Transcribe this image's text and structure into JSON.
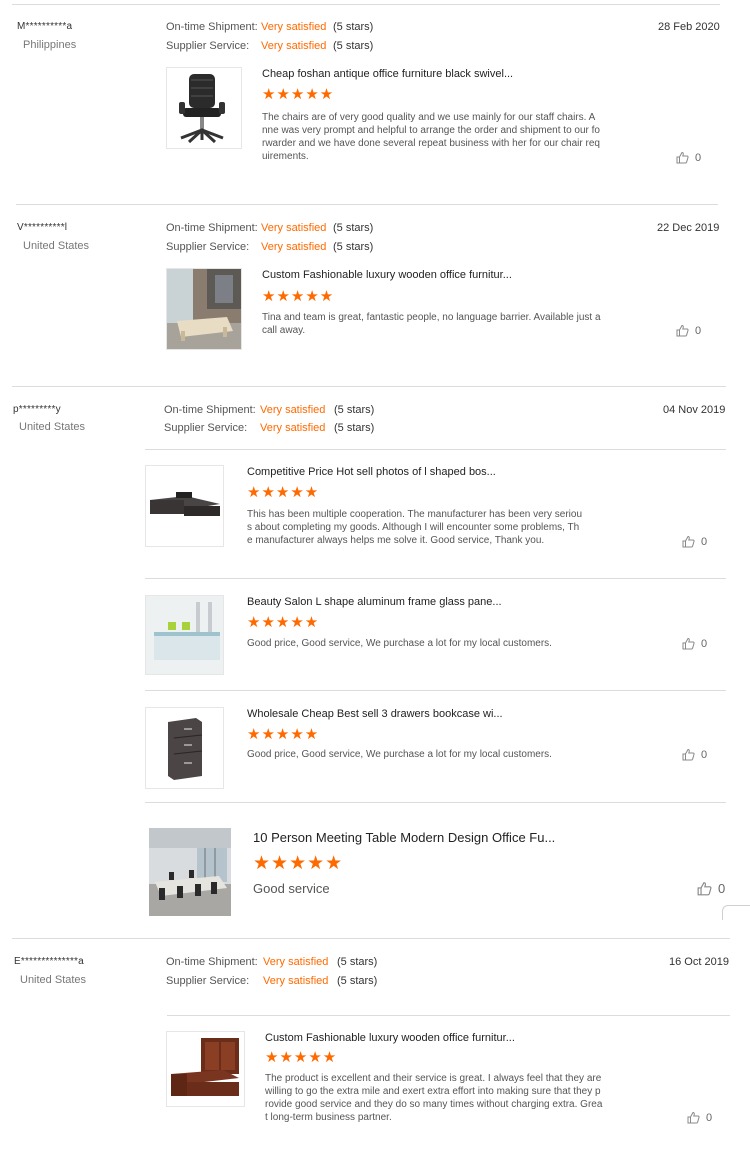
{
  "labels": {
    "shipment": "On-time Shipment:",
    "service": "Supplier Service:",
    "stars_glyphs": "★★★★★"
  },
  "reviews": [
    {
      "buyer": "M**********a",
      "country": "Philippines",
      "date": "28 Feb 2020",
      "shipment_value": "Very satisfied",
      "shipment_stars": "(5 stars)",
      "service_value": "Very satisfied",
      "service_stars": "(5 stars)",
      "items": [
        {
          "title": "Cheap foshan antique office furniture black swivel...",
          "text": "The chairs are of very good quality and we use mainly for our staff chairs.  A\nnne was very prompt and helpful to arrange the order and shipment to our fo\nrwarder and we have done several repeat business with her for our chair req\nuirements.",
          "likes": "0"
        }
      ]
    },
    {
      "buyer": "V**********l",
      "country": "United States",
      "date": "22 Dec 2019",
      "shipment_value": "Very satisfied",
      "shipment_stars": "(5 stars)",
      "service_value": "Very satisfied",
      "service_stars": "(5 stars)",
      "items": [
        {
          "title": "Custom Fashionable luxury wooden office furnitur...",
          "text": "Tina and team is great, fantastic people, no language barrier. Available just a\ncall away.",
          "likes": "0"
        }
      ]
    },
    {
      "buyer": "p*********y",
      "country": "United States",
      "date": "04 Nov 2019",
      "shipment_value": "Very satisfied",
      "shipment_stars": "(5 stars)",
      "service_value": "Very satisfied",
      "service_stars": "(5 stars)",
      "items": [
        {
          "title": "Competitive Price Hot sell photos of l shaped bos...",
          "text": "This has been multiple cooperation. The manufacturer has been very seriou\ns about completing my goods. Although I will encounter some problems, Th\ne manufacturer always helps me solve it. Good service, Thank you.",
          "likes": "0"
        },
        {
          "title": "Beauty Salon L shape aluminum frame glass pane...",
          "text": "Good price, Good service, We purchase a lot for my local customers.",
          "likes": "0"
        },
        {
          "title": "Wholesale Cheap Best sell 3 drawers bookcase wi...",
          "text": "Good price, Good service, We purchase a lot for my local customers.",
          "likes": "0"
        },
        {
          "title": "10 Person Meeting Table Modern Design Office Fu...",
          "text": "Good service",
          "likes": "0"
        }
      ]
    },
    {
      "buyer": "E**************a",
      "country": "United States",
      "date": "16 Oct 2019",
      "shipment_value": "Very satisfied",
      "shipment_stars": "(5 stars)",
      "service_value": "Very satisfied",
      "service_stars": "(5 stars)",
      "items": [
        {
          "title": "Custom Fashionable luxury wooden office furnitur...",
          "text": "The product is excellent and their service is great. I always feel that they are\nwilling to go the extra mile and exert extra effort into making sure that they p\nrovide good service and they do so many times without charging extra. Grea\nt long-term business partner.",
          "likes": "0"
        }
      ]
    }
  ]
}
